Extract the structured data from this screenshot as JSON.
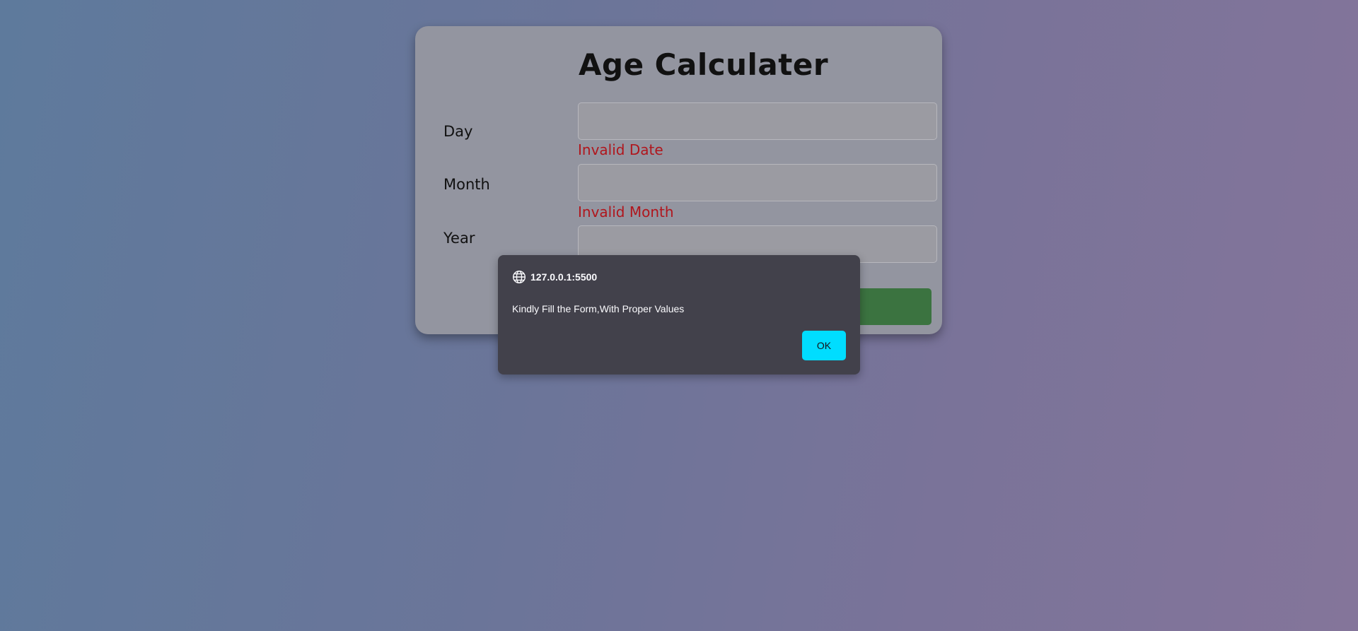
{
  "form": {
    "title": "Age Calculater",
    "day": {
      "label": "Day",
      "value": "",
      "error": "Invalid Date"
    },
    "month": {
      "label": "Month",
      "value": "",
      "error": "Invalid Month"
    },
    "year": {
      "label": "Year",
      "value": ""
    },
    "submit_label": ""
  },
  "dialog": {
    "origin": "127.0.0.1:5500",
    "origin_icon": "globe-icon",
    "message": "Kindly Fill the Form,With Proper Values",
    "ok_label": "OK"
  },
  "colors": {
    "error_text": "#b0161d",
    "submit_button": "#3b7340",
    "dialog_bg": "#42414b",
    "ok_button": "#00ddff"
  }
}
